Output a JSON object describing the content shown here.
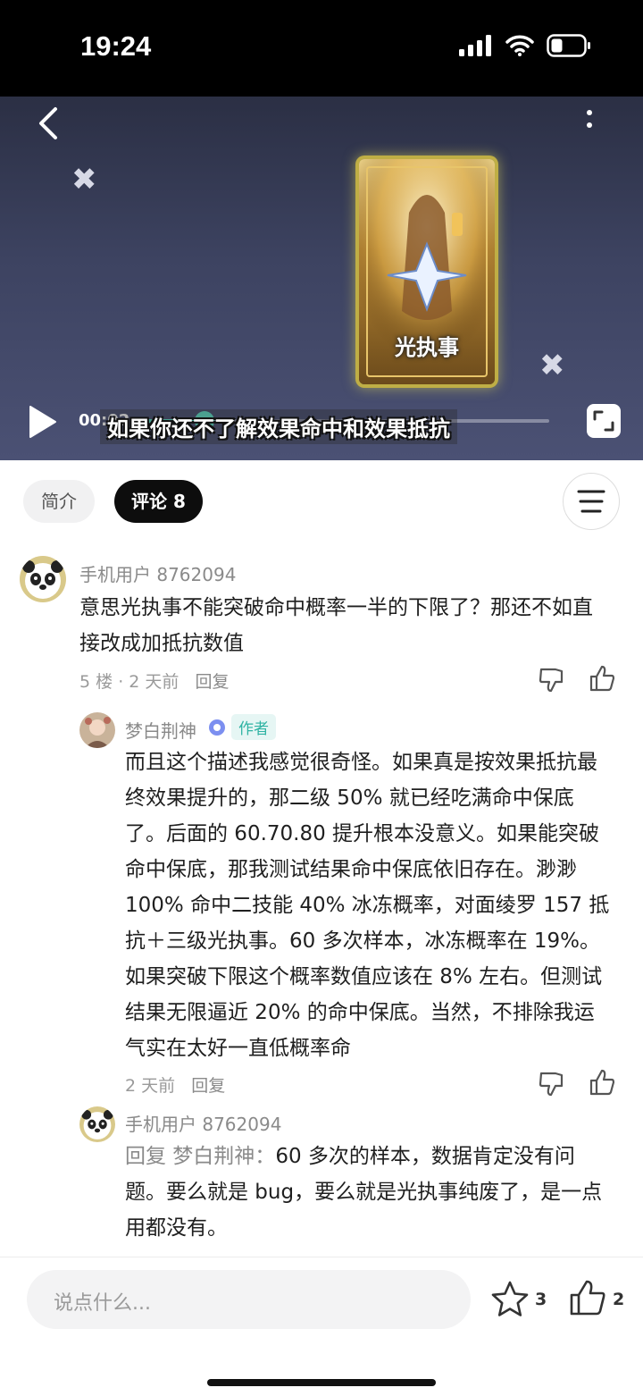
{
  "status_bar": {
    "time": "19:24"
  },
  "video": {
    "card_title": "光执事",
    "subtitle": "如果你还不了解效果命中和效果抵抗",
    "current_time": "00:02",
    "progress": 0.17
  },
  "tabs": {
    "intro": "简介",
    "comments": "评论 8"
  },
  "comments": [
    {
      "username": "手机用户 8762094",
      "text": "意思光执事不能突破命中概率一半的下限了？那还不如直接改成加抵抗数值",
      "floor": "5 楼",
      "time": "2 天前",
      "reply_label": "回复"
    }
  ],
  "replies": [
    {
      "username": "梦白荆神",
      "badge": "作者",
      "text": "而且这个描述我感觉很奇怪。如果真是按效果抵抗最终效果提升的，那二级 50% 就已经吃满命中保底了。后面的 60.70.80 提升根本没意义。如果能突破命中保底，那我测试结果命中保底依旧存在。渺渺 100% 命中二技能 40% 冰冻概率，对面绫罗 157 抵抗＋三级光执事。60 多次样本，冰冻概率在 19%。如果突破下限这个概率数值应该在 8% 左右。但测试结果无限逼近 20% 的命中保底。当然，不排除我运气实在太好一直低概率命",
      "time": "2 天前",
      "reply_label": "回复"
    },
    {
      "username": "手机用户 8762094",
      "reply_prefix": "回复 梦白荆神：",
      "text": "60 多次的样本，数据肯定没有问题。要么就是 bug，要么就是光执事纯废了，是一点用都没有。"
    }
  ],
  "bottom_bar": {
    "input_placeholder": "说点什么...",
    "star_count": "3",
    "like_count": "2"
  }
}
